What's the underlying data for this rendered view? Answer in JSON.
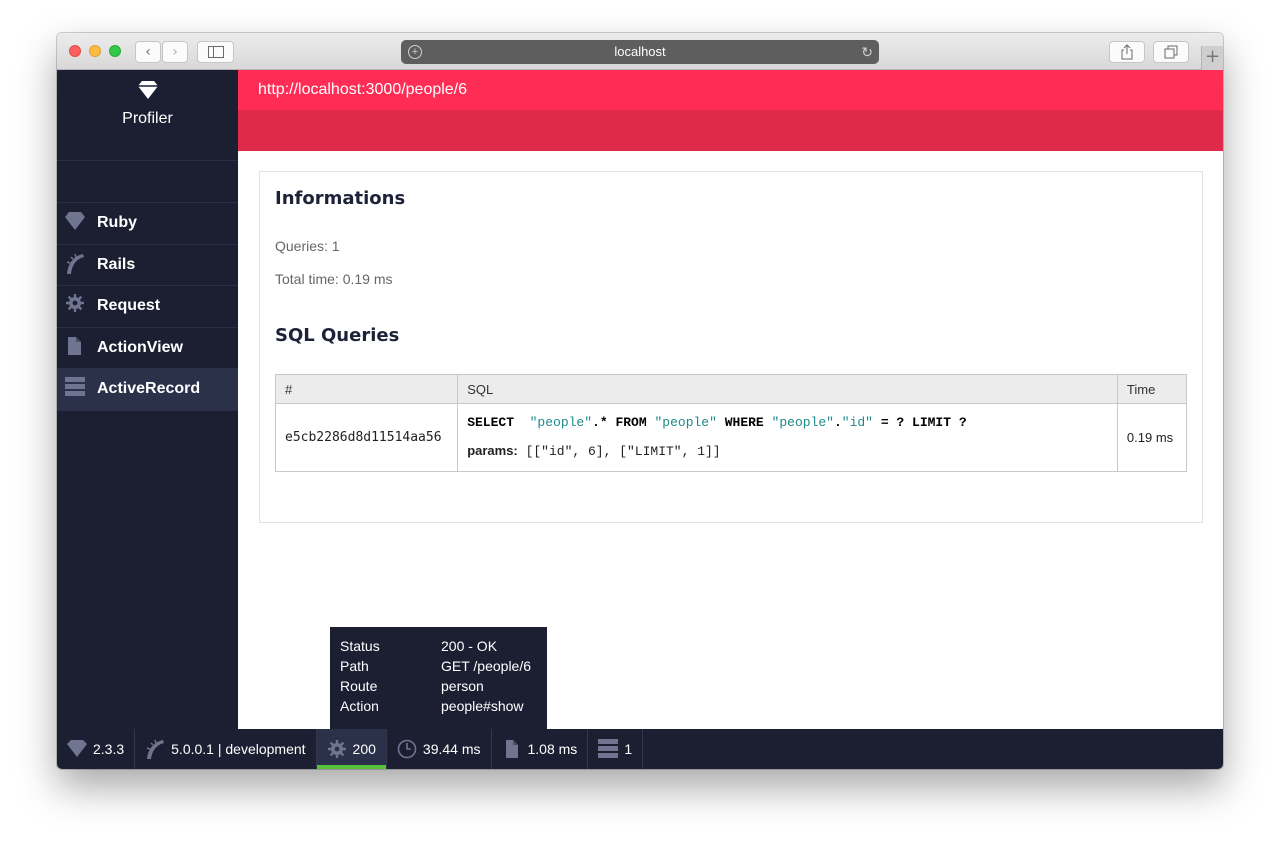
{
  "browser": {
    "address": "localhost",
    "nav_back": "‹",
    "nav_forward": "›"
  },
  "sidebar": {
    "brand": "Profiler",
    "items": [
      {
        "label": "Ruby",
        "icon": "ruby-gem-icon"
      },
      {
        "label": "Rails",
        "icon": "rails-icon"
      },
      {
        "label": "Request",
        "icon": "gear-icon"
      },
      {
        "label": "ActionView",
        "icon": "file-icon"
      },
      {
        "label": "ActiveRecord",
        "icon": "database-icon",
        "active": true
      }
    ]
  },
  "page": {
    "url": "http://localhost:3000/people/6",
    "informations": {
      "heading": "Informations",
      "queries": "Queries: 1",
      "total_time": "Total time: 0.19 ms"
    },
    "sql_section": {
      "heading": "SQL Queries",
      "columns": [
        "#",
        "SQL",
        "Time"
      ],
      "rows": [
        {
          "id": "e5cb2286d8d11514aa56",
          "query": {
            "select": "SELECT",
            "people_1": "\"people\"",
            "star": ".*",
            "from": "FROM",
            "people_2": "\"people\"",
            "where": "WHERE",
            "people_3": "\"people\"",
            "dot": ".",
            "id_col": "\"id\"",
            "rest": "= ? LIMIT ?"
          },
          "params_label": "params:",
          "params_value": "[[\"id\", 6], [\"LIMIT\", 1]]",
          "time": "0.19 ms"
        }
      ]
    }
  },
  "tooltip": {
    "rows": [
      {
        "key": "Status",
        "value": "200 - OK"
      },
      {
        "key": "Path",
        "value": "GET /people/6"
      },
      {
        "key": "Route",
        "value": "person"
      },
      {
        "key": "Action",
        "value": "people#show"
      }
    ]
  },
  "footer": {
    "ruby_version": "2.3.3",
    "rails_env": "5.0.0.1 | development",
    "status_code": "200",
    "request_time": "39.44 ms",
    "view_time": "1.08 ms",
    "db_count": "1"
  },
  "colors": {
    "accent": "#ff2d55",
    "sidebar_bg": "#1c1f32",
    "status_ok": "#55c23d"
  }
}
